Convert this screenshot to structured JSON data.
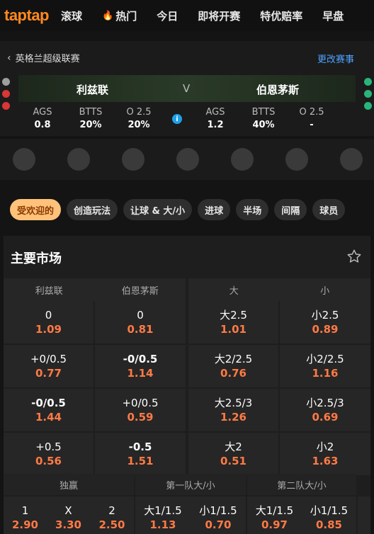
{
  "nav": {
    "logo": "taptap",
    "items": [
      "滚球",
      "热门",
      "今日",
      "即将开赛",
      "特优赔率",
      "早盘"
    ],
    "hot_index": 1
  },
  "breadcrumb": {
    "league": "英格兰超级联赛",
    "change_label": "更改赛事"
  },
  "match": {
    "home": "利兹联",
    "away": "伯恩茅斯",
    "vs": "V",
    "home_stats": [
      {
        "label": "AGS",
        "value": "0.8"
      },
      {
        "label": "BTTS",
        "value": "20%"
      },
      {
        "label": "O 2.5",
        "value": "20%"
      }
    ],
    "away_stats": [
      {
        "label": "AGS",
        "value": "1.2"
      },
      {
        "label": "BTTS",
        "value": "40%"
      },
      {
        "label": "O 2.5",
        "value": "-"
      }
    ],
    "info_icon": "i",
    "home_form_colors": [
      "#9e9e9e",
      "#d93636",
      "#d93636"
    ],
    "away_form_colors": [
      "#2ab37a",
      "#2ab37a",
      "#2ab37a"
    ]
  },
  "chips": [
    "受欢迎的",
    "创造玩法",
    "让球 & 大/小",
    "进球",
    "半场",
    "间隔",
    "球员"
  ],
  "market": {
    "title": "主要市场",
    "headers": [
      "利兹联",
      "伯恩茅斯",
      "大",
      "小"
    ],
    "rows": [
      {
        "h_line": "0",
        "h_odd": "1.09",
        "a_line": "0",
        "a_odd": "0.81",
        "o_line": "大2.5",
        "o_odd": "1.01",
        "u_line": "小2.5",
        "u_odd": "0.89"
      },
      {
        "h_line": "+0/0.5",
        "h_odd": "0.77",
        "a_line": "-0/0.5",
        "a_odd": "1.14",
        "o_line": "大2/2.5",
        "o_odd": "0.76",
        "u_line": "小2/2.5",
        "u_odd": "1.16"
      },
      {
        "h_line": "-0/0.5",
        "h_odd": "1.44",
        "a_line": "+0/0.5",
        "a_odd": "0.59",
        "o_line": "大2.5/3",
        "o_odd": "1.26",
        "u_line": "小2.5/3",
        "u_odd": "0.69"
      },
      {
        "h_line": "+0.5",
        "h_odd": "0.56",
        "a_line": "-0.5",
        "a_odd": "1.51",
        "o_line": "大2",
        "o_odd": "0.51",
        "u_line": "小2",
        "u_odd": "1.63"
      }
    ],
    "sub_headers": [
      "独赢",
      "第一队大/小",
      "第二队大/小"
    ],
    "bottom": {
      "win": [
        {
          "line": "1",
          "odd": "2.90"
        },
        {
          "line": "X",
          "odd": "3.30"
        },
        {
          "line": "2",
          "odd": "2.50"
        }
      ],
      "team1": [
        {
          "line": "大1/1.5",
          "odd": "1.13"
        },
        {
          "line": "小1/1.5",
          "odd": "0.70"
        }
      ],
      "team2": [
        {
          "line": "大1/1.5",
          "odd": "0.97"
        },
        {
          "line": "小1/1.5",
          "odd": "0.85"
        }
      ]
    }
  },
  "colors": {
    "accent": "#ff8a1f",
    "odd": "#ff7a45",
    "link": "#4da3ff",
    "chip_active": "#ffc27a"
  }
}
